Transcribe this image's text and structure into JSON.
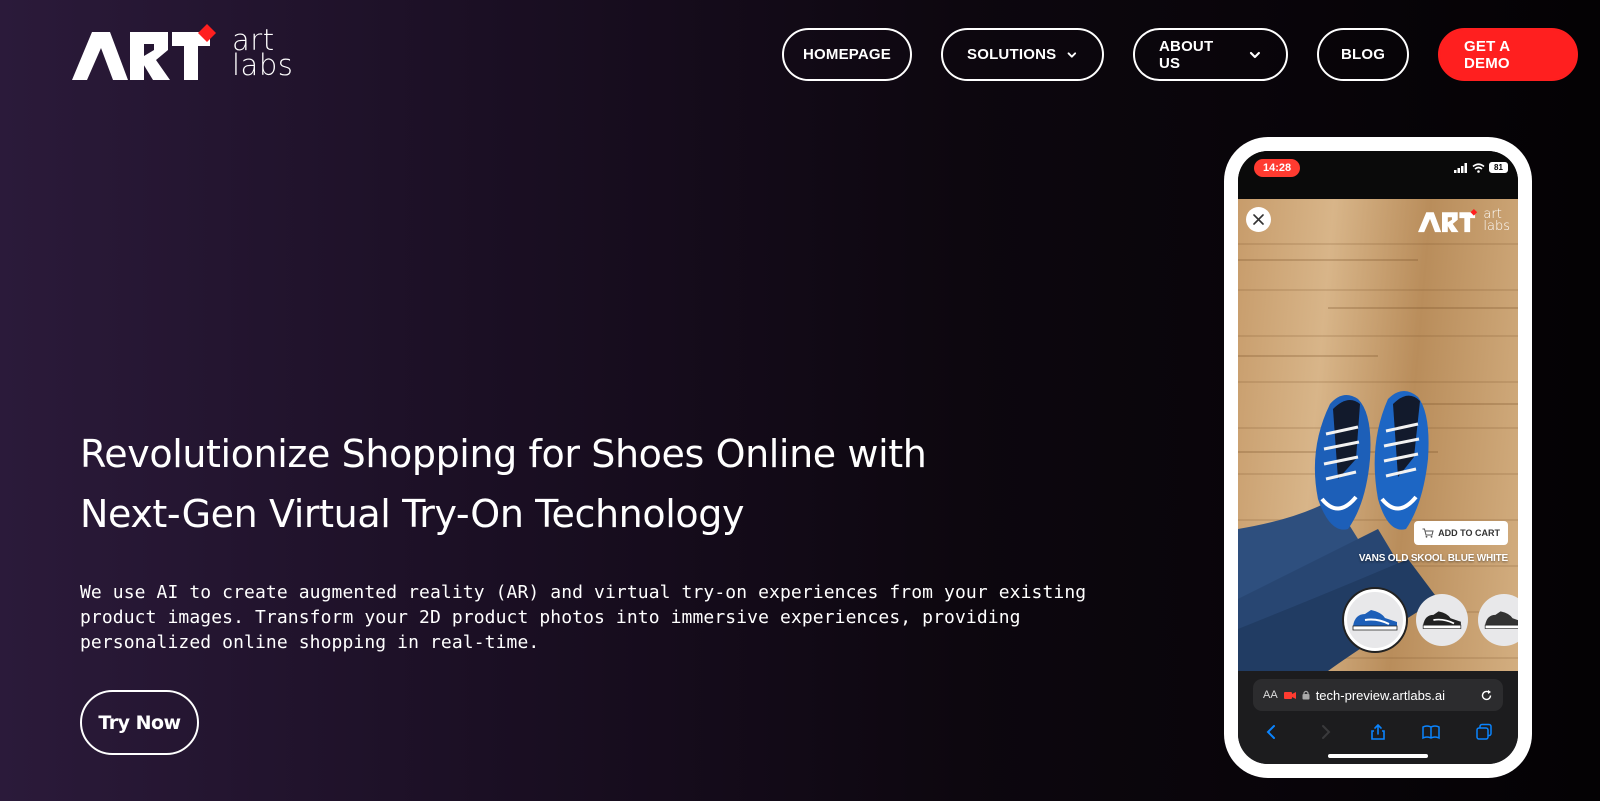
{
  "logo": {
    "wordmark": "ART",
    "line1": "art",
    "line2": "labs"
  },
  "nav": {
    "items": [
      {
        "label": "HOMEPAGE",
        "dropdown": false
      },
      {
        "label": "SOLUTIONS",
        "dropdown": true
      },
      {
        "label": "ABOUT US",
        "dropdown": true
      },
      {
        "label": "BLOG",
        "dropdown": false
      }
    ],
    "cta_label": "GET A DEMO"
  },
  "hero": {
    "title_line1": "Revolutionize Shopping for Shoes Online with",
    "title_line2": "Next-Gen Virtual Try-On Technology",
    "description": "We use AI to create augmented reality (AR) and virtual try-on experiences from your existing product images. Transform your 2D product photos into immersive experiences, providing personalized online shopping in real-time.",
    "cta_label": "Try Now"
  },
  "phone": {
    "time": "14:28",
    "battery": "81",
    "logo_line1": "art",
    "logo_line2": "labs",
    "add_to_cart": "ADD TO CART",
    "product_name": "VANS OLD SKOOL BLUE WHITE",
    "url_aa": "AA",
    "url": "tech-preview.artlabs.ai"
  },
  "colors": {
    "accent_red": "#ff1f1f",
    "background_start": "#2b1a3a",
    "background_end": "#040204"
  },
  "icons": [
    "chevron-down-icon",
    "close-icon",
    "cart-icon",
    "lock-icon",
    "reload-icon",
    "back-icon",
    "forward-icon",
    "share-icon",
    "book-icon",
    "tabs-icon",
    "signal-icon",
    "wifi-icon",
    "battery-icon",
    "camera-record-icon"
  ]
}
